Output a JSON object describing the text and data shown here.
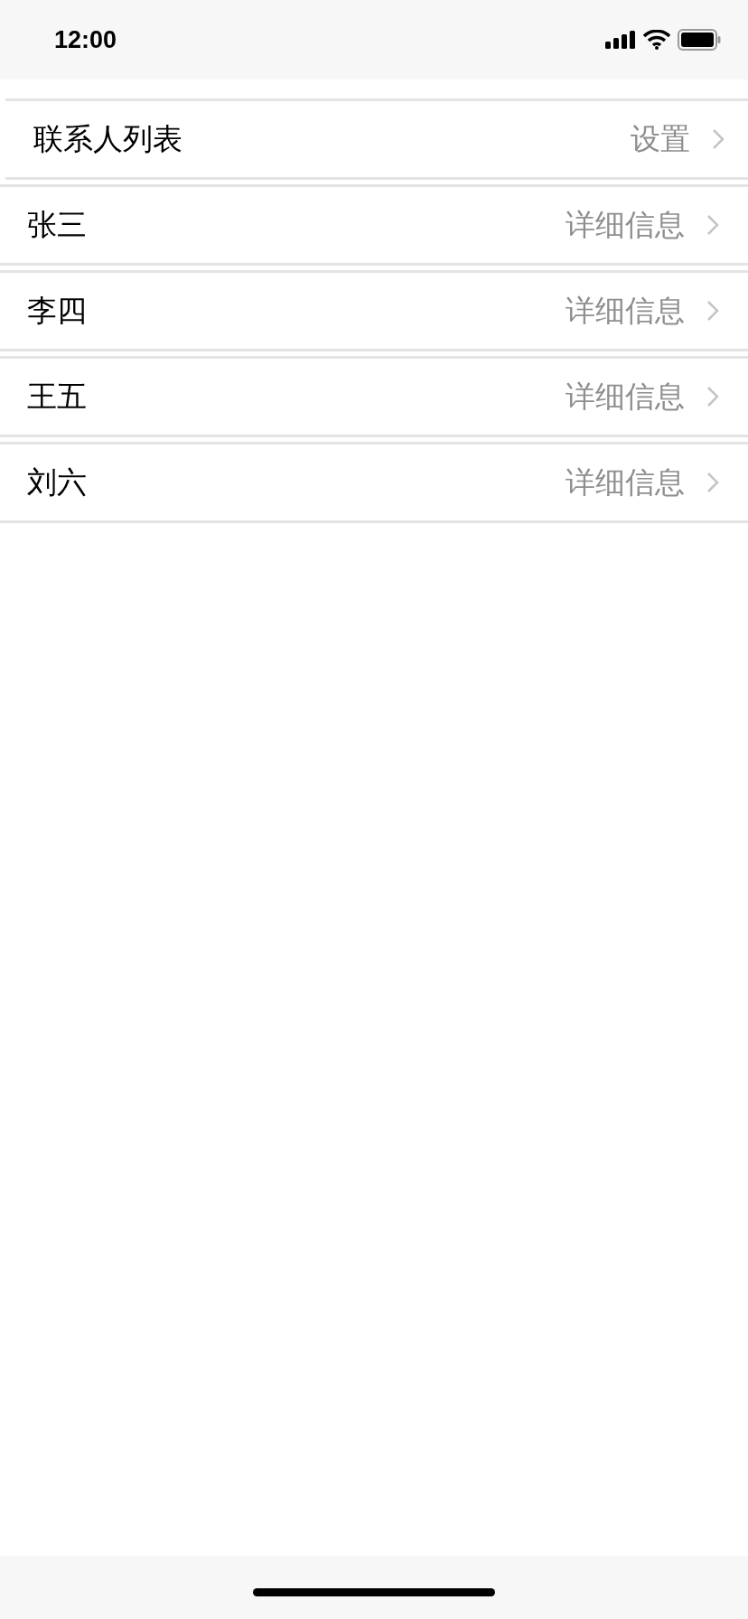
{
  "status_bar": {
    "time": "12:00"
  },
  "header": {
    "title": "联系人列表",
    "action": "设置"
  },
  "contacts": [
    {
      "name": "张三",
      "detail": "详细信息"
    },
    {
      "name": "李四",
      "detail": "详细信息"
    },
    {
      "name": "王五",
      "detail": "详细信息"
    },
    {
      "name": "刘六",
      "detail": "详细信息"
    }
  ]
}
